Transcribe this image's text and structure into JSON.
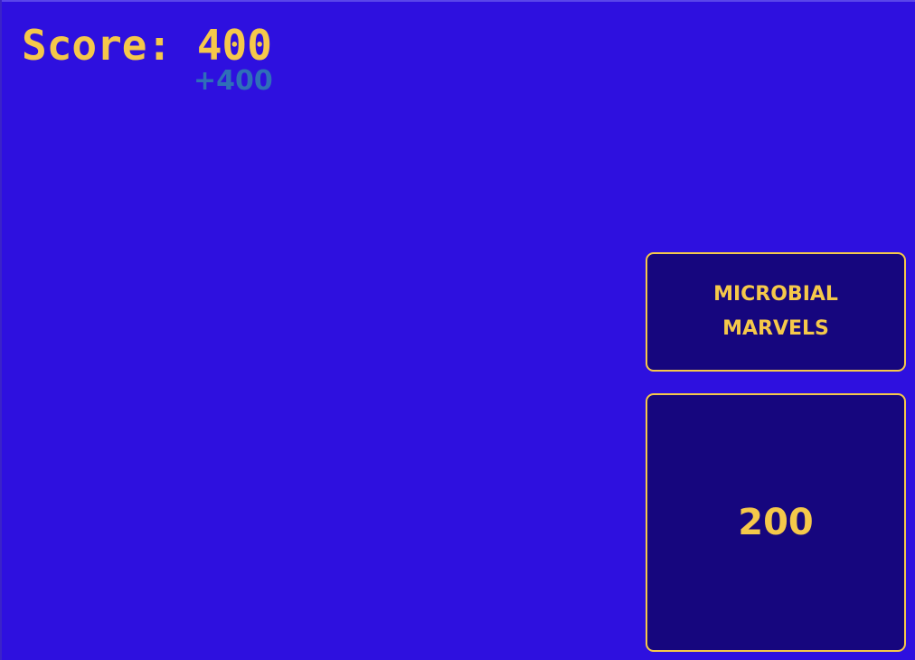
{
  "score": {
    "label": "Score: 400",
    "delta": "+400"
  },
  "board": {
    "category": "MICROBIAL MARVELS",
    "value": "200"
  },
  "colors": {
    "background": "#2e10df",
    "card": "#16067e",
    "accent": "#f5c84a",
    "delta": "#2f6fb8"
  }
}
